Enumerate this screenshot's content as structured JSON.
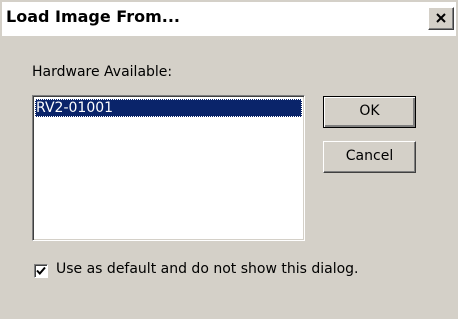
{
  "window": {
    "title": "Load Image From...",
    "close_icon": "close-icon"
  },
  "hardware": {
    "label": "Hardware Available:",
    "items": [
      {
        "label": "RV2-01001",
        "selected": true
      }
    ]
  },
  "buttons": {
    "ok_label": "OK",
    "cancel_label": "Cancel"
  },
  "default_option": {
    "label": "Use as default and do not show this dialog.",
    "checked": true
  },
  "colors": {
    "dialog_bg": "#d4d0c8",
    "selection_bg": "#0a246a",
    "selection_text": "#ffffff"
  }
}
